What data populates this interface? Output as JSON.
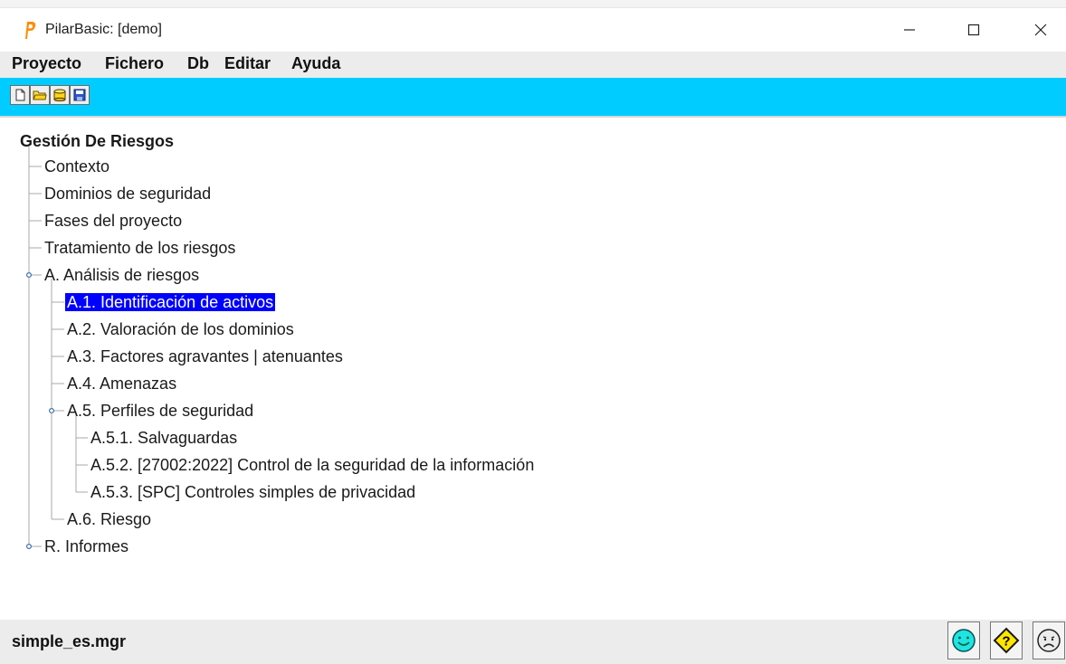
{
  "window": {
    "title": "PilarBasic: [demo]",
    "app_icon": "pilar-p-icon"
  },
  "menubar": {
    "items": [
      "Proyecto",
      "Fichero",
      "Db",
      "Editar",
      "Ayuda"
    ]
  },
  "toolbar": {
    "buttons": [
      "new-file-icon",
      "open-folder-icon",
      "database-icon",
      "save-icon"
    ],
    "background": "#00ccff"
  },
  "tree": {
    "root": "Gestión De Riesgos",
    "items": [
      "Contexto",
      "Dominios de seguridad",
      "Fases del proyecto",
      "Tratamiento de los riesgos",
      "A. Análisis de riesgos",
      "A.1. Identificación de activos",
      "A.2. Valoración de los dominios",
      "A.3. Factores agravantes | atenuantes",
      "A.4. Amenazas",
      "A.5. Perfiles de seguridad",
      "A.5.1. Salvaguardas",
      "A.5.2. [27002:2022] Control de la seguridad de la información",
      "A.5.3. [SPC] Controles simples de privacidad",
      "A.6. Riesgo",
      "R. Informes"
    ],
    "selected": "A.1. Identificación de activos",
    "selection_color": "#0000ff"
  },
  "statusbar": {
    "file": "simple_es.mgr",
    "buttons": [
      "happy-face-icon",
      "warning-question-icon",
      "sad-face-icon"
    ]
  }
}
